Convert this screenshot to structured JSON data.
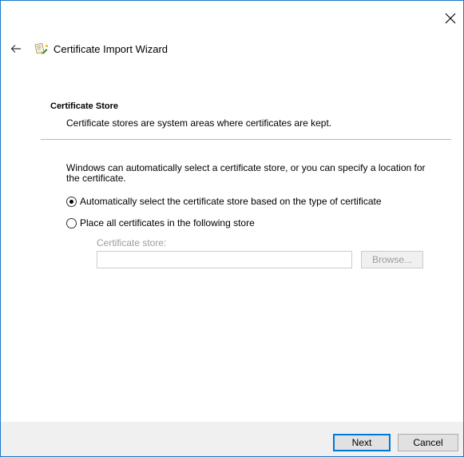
{
  "window": {
    "title": "Certificate Import Wizard"
  },
  "header": {
    "section_title": "Certificate Store",
    "section_subtitle": "Certificate stores are system areas where certificates are kept."
  },
  "content": {
    "description": "Windows can automatically select a certificate store, or you can specify a location for the certificate.",
    "options": [
      {
        "label": "Automatically select the certificate store based on the type of certificate",
        "checked": true
      },
      {
        "label": "Place all certificates in the following store",
        "checked": false
      }
    ],
    "store_label": "Certificate store:",
    "store_value": "",
    "browse_label": "Browse..."
  },
  "footer": {
    "next_label": "Next",
    "cancel_label": "Cancel"
  },
  "colors": {
    "accent": "#0078d7",
    "window_border": "#1979ca",
    "footer_bg": "#f0f0f0",
    "disabled_text": "#9c9c9c"
  },
  "icons": {
    "close": "close-icon",
    "back": "back-arrow-icon",
    "wizard": "certificate-wizard-icon"
  }
}
